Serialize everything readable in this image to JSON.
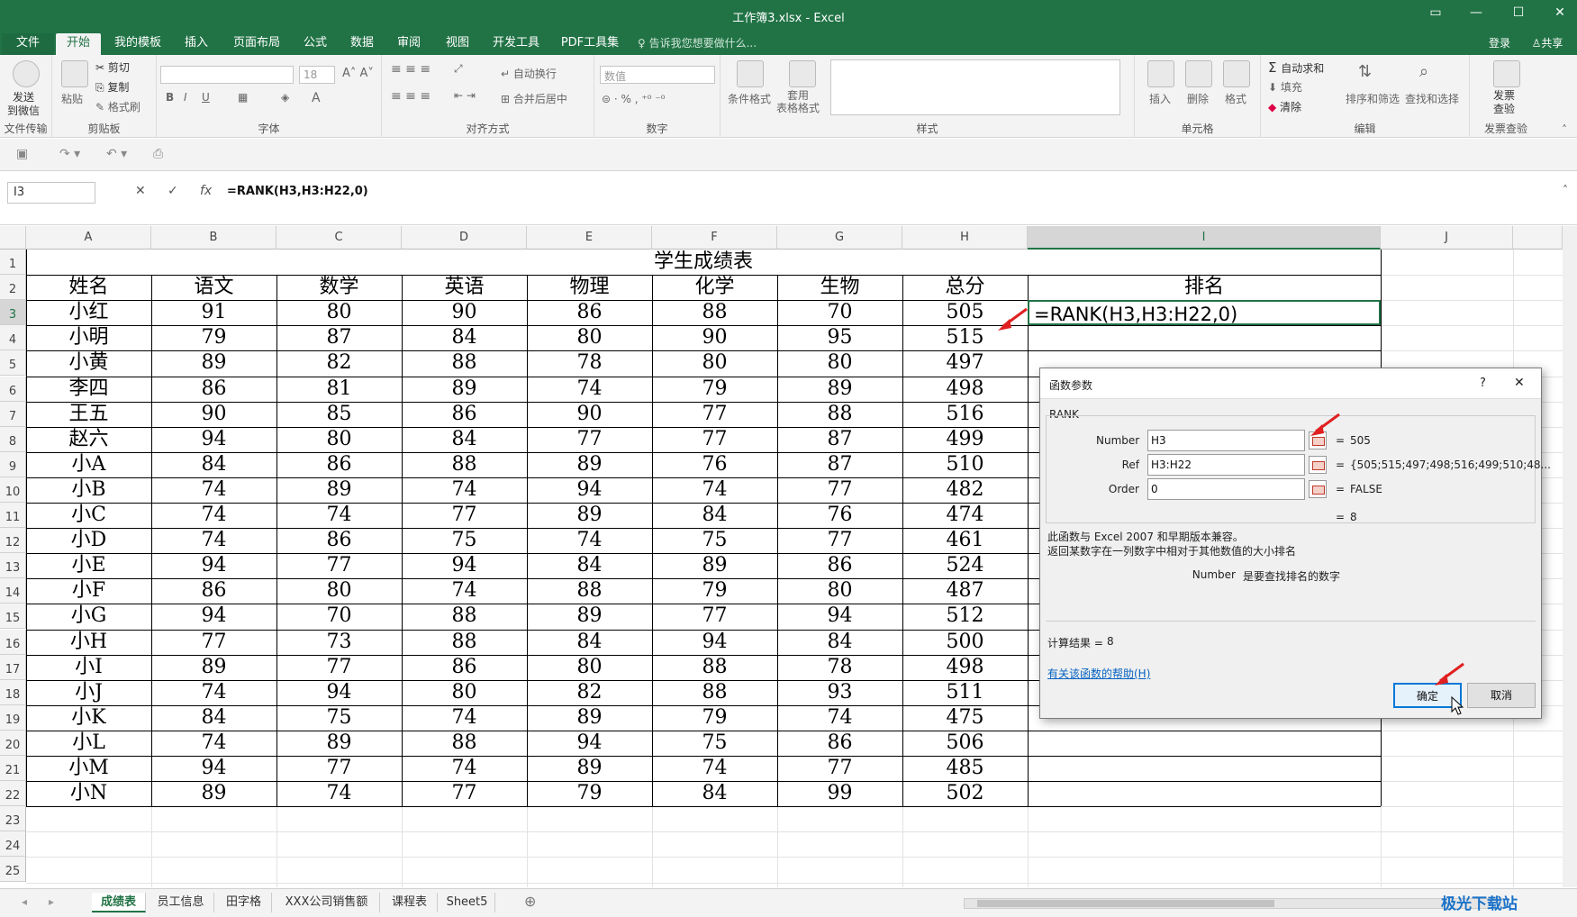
{
  "window": {
    "title": "工作簿3.xlsx - Excel"
  },
  "ribbon_tabs": [
    "文件",
    "开始",
    "我的模板",
    "插入",
    "页面布局",
    "公式",
    "数据",
    "审阅",
    "视图",
    "开发工具",
    "PDF工具集"
  ],
  "tell_me": "告诉我您想要做什么...",
  "account": {
    "login": "登录",
    "share": "共享"
  },
  "ribbon": {
    "send_wechat": "发送\n到微信",
    "paste": "粘贴",
    "cut": "剪切",
    "copy": "复制",
    "format_painter": "格式刷",
    "font_size": "18",
    "wrap_text": "自动换行",
    "merge_center": "合并后居中",
    "number_format": "数值",
    "conditional_format": "条件格式",
    "table_format": "套用\n表格格式",
    "insert": "插入",
    "delete": "删除",
    "format": "格式",
    "autosum": "自动求和",
    "fill": "填充",
    "clear": "清除",
    "sort_filter": "排序和筛选",
    "find_select": "查找和选择",
    "invoice_check": "发票\n查验",
    "groups": [
      "文件传输",
      "剪贴板",
      "字体",
      "对齐方式",
      "数字",
      "样式",
      "单元格",
      "编辑",
      "发票查验"
    ]
  },
  "formula_bar": {
    "name_box": "I3",
    "formula": "=RANK(H3,H3:H22,0)"
  },
  "columns": [
    "A",
    "B",
    "C",
    "D",
    "E",
    "F",
    "G",
    "H",
    "I",
    "J"
  ],
  "rows": [
    "1",
    "2",
    "3",
    "4",
    "5",
    "6",
    "7",
    "8",
    "9",
    "10",
    "11",
    "12",
    "13",
    "14",
    "15",
    "16",
    "17",
    "18",
    "19",
    "20",
    "21",
    "22",
    "23",
    "24",
    "25"
  ],
  "table": {
    "title": "学生成绩表",
    "headers": [
      "姓名",
      "语文",
      "数学",
      "英语",
      "物理",
      "化学",
      "生物",
      "总分",
      "排名"
    ],
    "data": [
      [
        "小红",
        "91",
        "80",
        "90",
        "86",
        "88",
        "70",
        "505"
      ],
      [
        "小明",
        "79",
        "87",
        "84",
        "80",
        "90",
        "95",
        "515"
      ],
      [
        "小黄",
        "89",
        "82",
        "88",
        "78",
        "80",
        "80",
        "497"
      ],
      [
        "李四",
        "86",
        "81",
        "89",
        "74",
        "79",
        "89",
        "498"
      ],
      [
        "王五",
        "90",
        "85",
        "86",
        "90",
        "77",
        "88",
        "516"
      ],
      [
        "赵六",
        "94",
        "80",
        "84",
        "77",
        "77",
        "87",
        "499"
      ],
      [
        "小A",
        "84",
        "86",
        "88",
        "89",
        "76",
        "87",
        "510"
      ],
      [
        "小B",
        "74",
        "89",
        "74",
        "94",
        "74",
        "77",
        "482"
      ],
      [
        "小C",
        "74",
        "74",
        "77",
        "89",
        "84",
        "76",
        "474"
      ],
      [
        "小D",
        "74",
        "86",
        "75",
        "74",
        "75",
        "77",
        "461"
      ],
      [
        "小E",
        "94",
        "77",
        "94",
        "84",
        "89",
        "86",
        "524"
      ],
      [
        "小F",
        "86",
        "80",
        "74",
        "88",
        "79",
        "80",
        "487"
      ],
      [
        "小G",
        "94",
        "70",
        "88",
        "89",
        "77",
        "94",
        "512"
      ],
      [
        "小H",
        "77",
        "73",
        "88",
        "84",
        "94",
        "84",
        "500"
      ],
      [
        "小I",
        "89",
        "77",
        "86",
        "80",
        "88",
        "78",
        "498"
      ],
      [
        "小J",
        "74",
        "94",
        "80",
        "82",
        "88",
        "93",
        "511"
      ],
      [
        "小K",
        "84",
        "75",
        "74",
        "89",
        "79",
        "74",
        "475"
      ],
      [
        "小L",
        "74",
        "89",
        "88",
        "94",
        "75",
        "86",
        "506"
      ],
      [
        "小M",
        "94",
        "77",
        "74",
        "89",
        "74",
        "77",
        "485"
      ],
      [
        "小N",
        "89",
        "74",
        "77",
        "79",
        "84",
        "99",
        "502"
      ]
    ],
    "editing_formula": "=RANK(H3,H3:H22,0)"
  },
  "dialog": {
    "title": "函数参数",
    "help": "?",
    "function_name": "RANK",
    "args": [
      {
        "label": "Number",
        "value": "H3",
        "result": "505"
      },
      {
        "label": "Ref",
        "value": "H3:H22",
        "result": "{505;515;497;498;516;499;510;48..."
      },
      {
        "label": "Order",
        "value": "0",
        "result": "FALSE"
      }
    ],
    "eq": "=",
    "overall_result": "8",
    "desc1": "此函数与 Excel 2007 和早期版本兼容。",
    "desc2": "返回某数字在一列数字中相对于其他数值的大小排名",
    "arg_help_label": "Number",
    "arg_help_text": "是要查找排名的数字",
    "calc_result_label": "计算结果 =",
    "calc_result_value": "8",
    "help_link": "有关该函数的帮助(H)",
    "ok": "确定",
    "cancel": "取消"
  },
  "sheets": [
    "成绩表",
    "员工信息",
    "田字格",
    "XXX公司销售额",
    "课程表",
    "Sheet5"
  ],
  "watermark": "极光下载站",
  "colors": {
    "excel_green": "#217346",
    "arrow_red": "#e02020",
    "link_blue": "#0563c1"
  }
}
